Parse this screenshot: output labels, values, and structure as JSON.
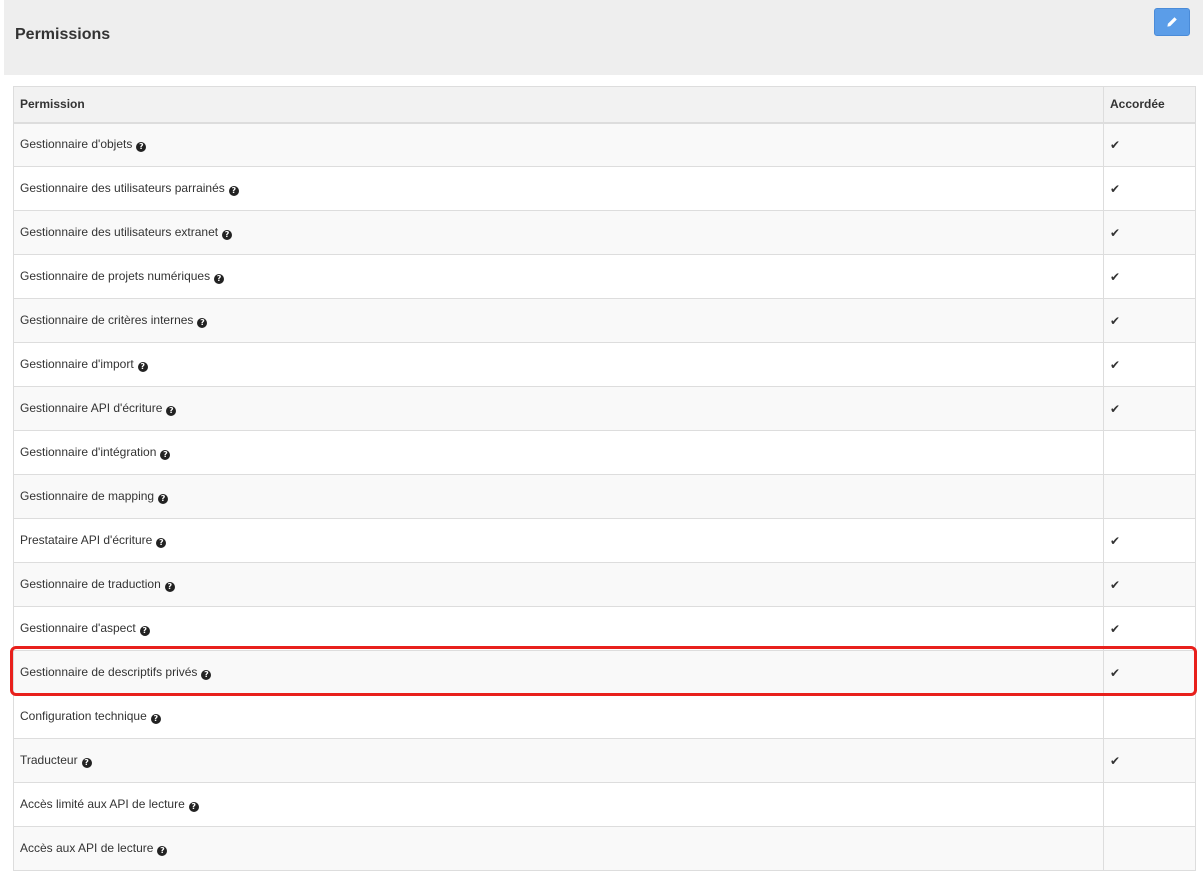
{
  "panel": {
    "title": "Permissions",
    "edit_icon": "pencil-icon",
    "accent_color": "#5b9de8"
  },
  "table": {
    "headers": {
      "permission": "Permission",
      "granted": "Accordée"
    },
    "rows": [
      {
        "label": "Gestionnaire d'objets",
        "granted": true
      },
      {
        "label": "Gestionnaire des utilisateurs parrainés",
        "granted": true
      },
      {
        "label": "Gestionnaire des utilisateurs extranet",
        "granted": true
      },
      {
        "label": "Gestionnaire de projets numériques",
        "granted": true
      },
      {
        "label": "Gestionnaire de critères internes",
        "granted": true
      },
      {
        "label": "Gestionnaire d'import",
        "granted": true
      },
      {
        "label": "Gestionnaire API d'écriture",
        "granted": true
      },
      {
        "label": "Gestionnaire d'intégration",
        "granted": false
      },
      {
        "label": "Gestionnaire de mapping",
        "granted": false
      },
      {
        "label": "Prestataire API d'écriture",
        "granted": true
      },
      {
        "label": "Gestionnaire de traduction",
        "granted": true
      },
      {
        "label": "Gestionnaire d'aspect",
        "granted": true
      },
      {
        "label": "Gestionnaire de descriptifs privés",
        "granted": true,
        "highlighted": true
      },
      {
        "label": "Configuration technique",
        "granted": false
      },
      {
        "label": "Traducteur",
        "granted": true
      },
      {
        "label": "Accès limité aux API de lecture",
        "granted": false
      },
      {
        "label": "Accès aux API de lecture",
        "granted": false
      }
    ],
    "help_icon": "question-circle-icon",
    "check_icon": "check-icon",
    "highlight_color": "#e8201c"
  }
}
